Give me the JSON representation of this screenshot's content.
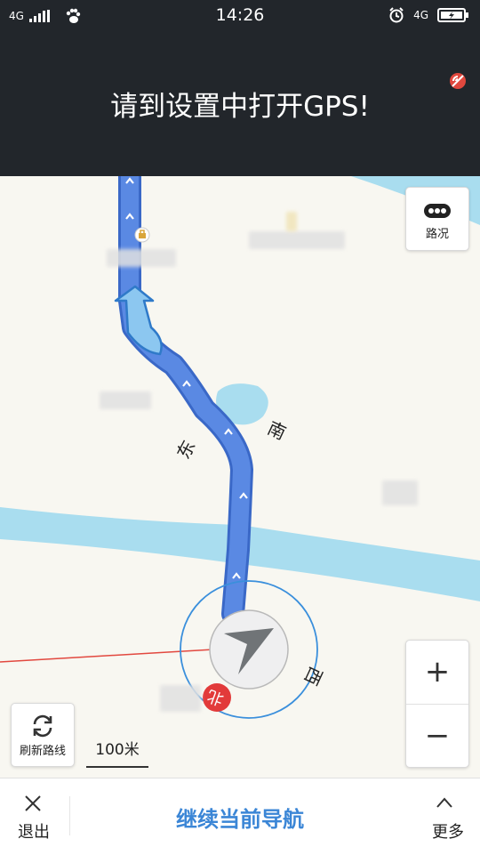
{
  "status_bar": {
    "time": "14:26",
    "network_left": "4G",
    "network_right": "4G",
    "icons": [
      "signal-icon",
      "paw-icon",
      "alarm-icon",
      "battery-icon"
    ]
  },
  "banner": {
    "message": "请到设置中打开GPS!"
  },
  "map": {
    "compass": {
      "east": "东",
      "south": "南",
      "west": "西",
      "north": "北"
    },
    "colors": {
      "route": "#4f7edc",
      "water": "#a9ddef",
      "north_badge": "#e23a3a",
      "compass_ring": "#3a8fdc"
    }
  },
  "controls": {
    "traffic_label": "路况",
    "refresh_label": "刷新路线",
    "scale_label": "100米",
    "zoom_in": "+",
    "zoom_out": "−"
  },
  "bottom_bar": {
    "exit_label": "退出",
    "continue_label": "继续当前导航",
    "more_label": "更多"
  }
}
